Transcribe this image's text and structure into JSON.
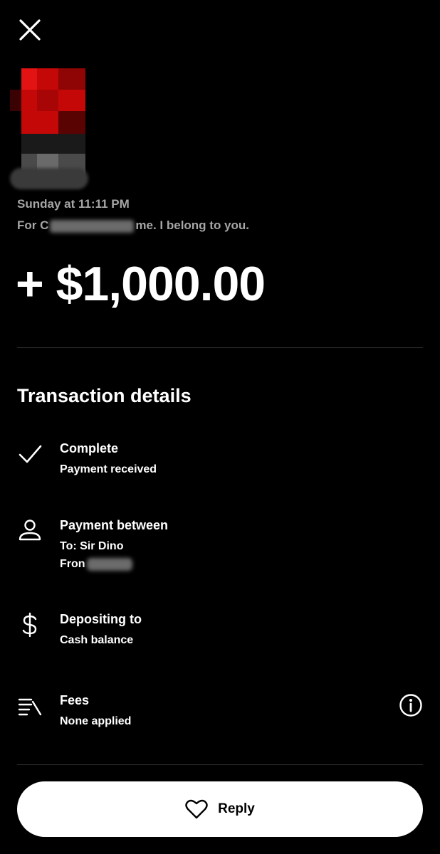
{
  "header": {
    "close_icon": "close-icon",
    "avatar_obscured": true
  },
  "transaction": {
    "timestamp": "Sunday at 11:11 PM",
    "note_prefix": "For C",
    "note_suffix": "me. I belong to you.",
    "amount": "+ $1,000.00"
  },
  "details": {
    "title": "Transaction details",
    "status": {
      "icon": "checkmark-icon",
      "label": "Complete",
      "value": "Payment received"
    },
    "parties": {
      "icon": "person-icon",
      "label": "Payment between",
      "to": "To: Sir Dino",
      "from_prefix": "Fron"
    },
    "deposit": {
      "icon": "dollar-icon",
      "label": "Depositing to",
      "value": "Cash balance"
    },
    "fees": {
      "icon": "list-icon",
      "label": "Fees",
      "value": "None applied",
      "info_icon": "info-icon"
    }
  },
  "footer": {
    "reply_label": "Reply",
    "reply_icon": "heart-icon"
  },
  "colors": {
    "background": "#000000",
    "primary_text": "#ffffff",
    "secondary_text": "#a6a6a6",
    "avatar_red": "#d10a0a",
    "button_bg": "#ffffff",
    "button_text": "#000000"
  }
}
